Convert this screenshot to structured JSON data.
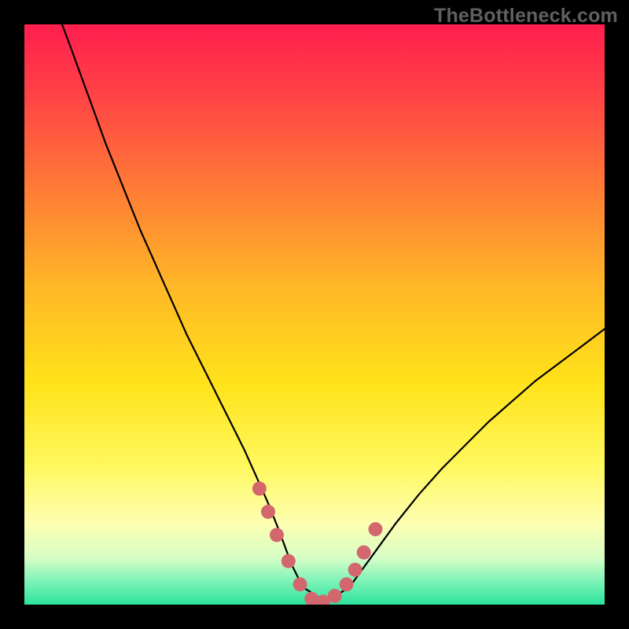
{
  "watermark": "TheBottleneck.com",
  "colors": {
    "frame": "#000000",
    "curve": "#000000",
    "markers": "#d4676e",
    "good_band": "#2be39c"
  },
  "chart_data": {
    "type": "line",
    "title": "",
    "xlabel": "",
    "ylabel": "",
    "x_range_pct": [
      0,
      100
    ],
    "y_range_pct": [
      0,
      100
    ],
    "gradient_stops": [
      {
        "pct": 0,
        "color": "#ff1e4e"
      },
      {
        "pct": 12,
        "color": "#ff4246"
      },
      {
        "pct": 28,
        "color": "#ff7a36"
      },
      {
        "pct": 45,
        "color": "#ffb727"
      },
      {
        "pct": 62,
        "color": "#ffe31a"
      },
      {
        "pct": 76,
        "color": "#fff85e"
      },
      {
        "pct": 86,
        "color": "#fdffb1"
      },
      {
        "pct": 92,
        "color": "#d6fec6"
      },
      {
        "pct": 96,
        "color": "#7df3b8"
      },
      {
        "pct": 100,
        "color": "#2be39c"
      }
    ],
    "series": [
      {
        "name": "bottleneck-curve",
        "x": [
          6.5,
          8,
          10,
          12,
          14,
          16,
          18,
          20,
          22,
          24,
          26,
          28,
          30,
          32,
          34,
          36,
          38,
          40,
          42,
          44,
          46,
          48,
          52,
          56,
          60,
          64,
          68,
          72,
          76,
          80,
          84,
          88,
          92,
          96,
          100
        ],
        "y": [
          100,
          96,
          90.5,
          85,
          79.5,
          74.5,
          69.5,
          64.5,
          60,
          55.5,
          51,
          46.5,
          42.5,
          38.5,
          34.5,
          30.5,
          26.5,
          22,
          17.5,
          12.5,
          7,
          3,
          0.5,
          3,
          8.5,
          14,
          19,
          23.5,
          27.5,
          31.5,
          35,
          38.5,
          41.5,
          44.5,
          47.5
        ]
      }
    ],
    "markers": {
      "name": "highlight-points",
      "x": [
        40.5,
        42,
        43.5,
        45.5,
        47.5,
        49.5,
        51.5,
        53.5,
        55.5,
        57,
        58.5,
        60.5
      ],
      "y": [
        20,
        16,
        12,
        7.5,
        3.5,
        1,
        0.5,
        1.5,
        3.5,
        6,
        9,
        13
      ]
    }
  }
}
